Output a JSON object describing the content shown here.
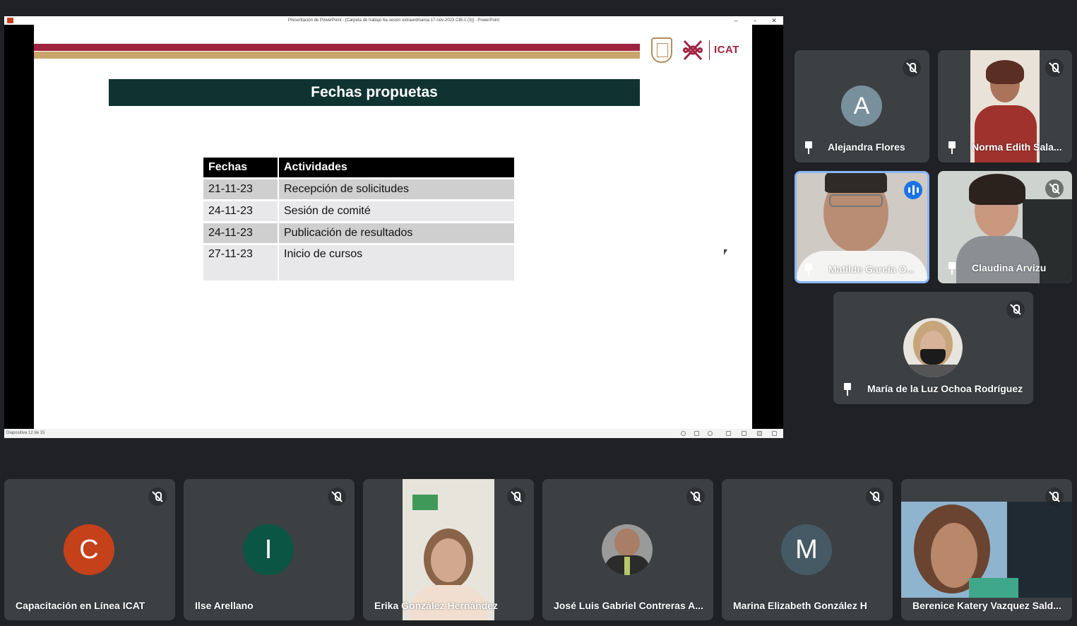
{
  "presentation": {
    "window_title": "Presentación de PowerPoint - [Carpeta de trabajo 6a sesion extraordinaroa 17-nov-2023 CIB-1 (3)] - PowerPoint",
    "status_text": "Diapositiva 12 de 15",
    "slide": {
      "logo_text": "ICAT",
      "title": "Fechas propuetas",
      "table": {
        "headers": [
          "Fechas",
          "Actividades"
        ],
        "rows": [
          {
            "date": "21-11-23",
            "activity": "Recepción de solicitudes"
          },
          {
            "date": "24-11-23",
            "activity": "Sesión de comité"
          },
          {
            "date": "24-11-23",
            "activity": "Publicación de resultados"
          },
          {
            "date": "27-11-23",
            "activity": "Inicio de cursos"
          }
        ]
      }
    }
  },
  "participants": [
    {
      "name": "Alejandra Flores",
      "initial": "A",
      "avatar_color": "#78909c",
      "muted": true,
      "pinned": true
    },
    {
      "name": "Norma Edith Sala...",
      "muted": true,
      "pinned": true
    },
    {
      "name": "Matilde García O...",
      "speaking": true,
      "pinned": true
    },
    {
      "name": "Claudina Arvizu",
      "muted": true,
      "pinned": true
    },
    {
      "name": "María de la Luz Ochoa Rodríguez",
      "muted": true,
      "pinned": true
    },
    {
      "name": "Capacitación en Línea ICAT",
      "initial": "C",
      "avatar_color": "#c5411a",
      "muted": true
    },
    {
      "name": "Ilse Arellano",
      "initial": "I",
      "avatar_color": "#0b5545",
      "muted": true
    },
    {
      "name": "Erika González Hernández",
      "muted": true
    },
    {
      "name": "José Luis Gabriel Contreras A...",
      "muted": true
    },
    {
      "name": "Marina Elizabeth González H",
      "initial": "M",
      "avatar_color": "#455a64",
      "muted": true
    },
    {
      "name": "Berenice Katery Vazquez Sald...",
      "muted": true
    }
  ]
}
